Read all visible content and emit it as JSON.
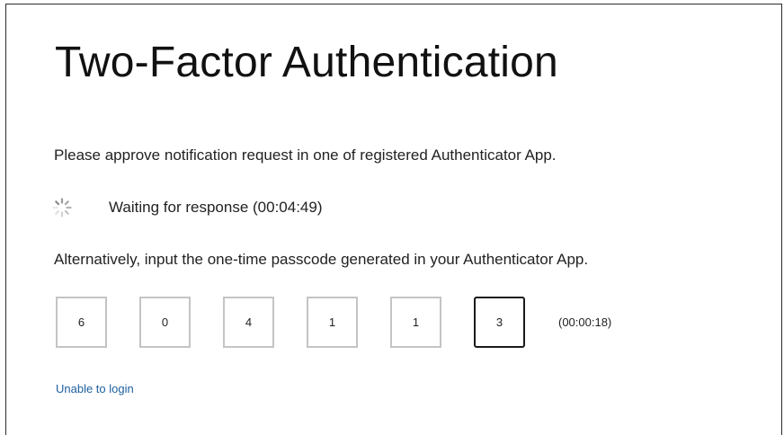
{
  "page": {
    "title": "Two-Factor Authentication",
    "instruction": "Please approve notification request in one of registered Authenticator App.",
    "waiting": {
      "text": "Waiting for response (00:04:49)",
      "icon": "loading-spinner-icon"
    },
    "alternative": "Alternatively, input the one-time passcode generated in your Authenticator App.",
    "otp": {
      "digits": [
        "6",
        "0",
        "4",
        "1",
        "1",
        "3"
      ],
      "active_index": 5,
      "timer": "(00:00:18)"
    },
    "unable_link": "Unable to login"
  },
  "colors": {
    "text": "#222222",
    "link": "#1d5f9e",
    "box_border": "#c4c4c4",
    "box_border_active": "#1a1a1a",
    "frame_border": "#2b2b2b"
  }
}
